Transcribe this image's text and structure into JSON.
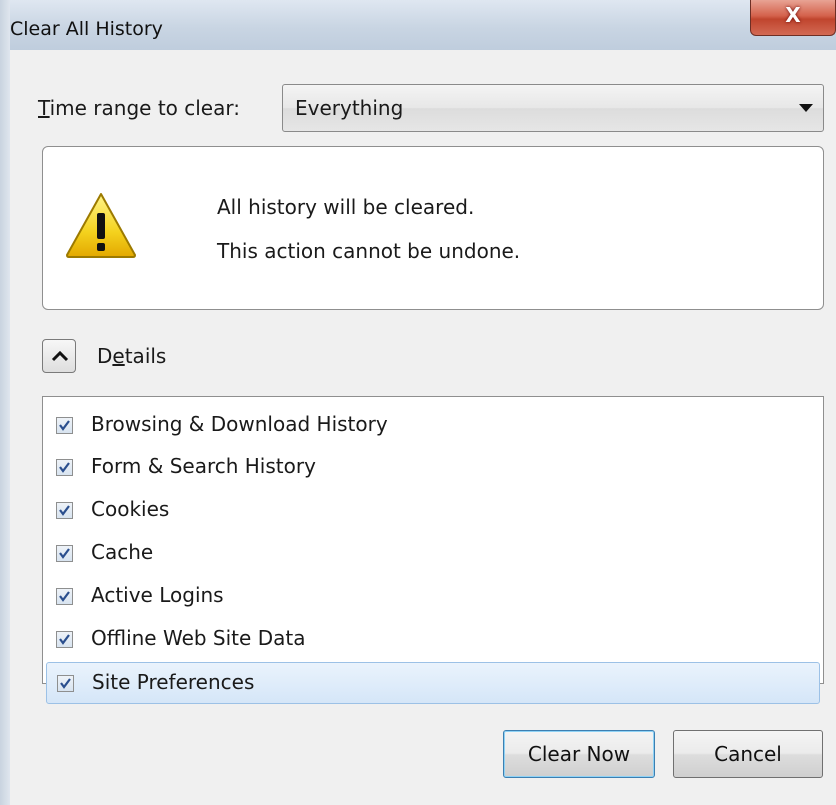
{
  "window": {
    "title": "Clear All History",
    "close_glyph": "X"
  },
  "time_range": {
    "label_first": "T",
    "label_rest": "ime range to clear:",
    "selected": "Everything"
  },
  "warning": {
    "icon": "warning-triangle-icon",
    "line1": "All history will be cleared.",
    "line2": "This action cannot be undone."
  },
  "details": {
    "label_pre": "D",
    "label_ul": "e",
    "label_post": "tails",
    "expanded": true
  },
  "items": [
    {
      "label": "Browsing & Download History",
      "checked": true
    },
    {
      "label": "Form & Search History",
      "checked": true
    },
    {
      "label": "Cookies",
      "checked": true
    },
    {
      "label": "Cache",
      "checked": true
    },
    {
      "label": "Active Logins",
      "checked": true
    },
    {
      "label": "Offline Web Site Data",
      "checked": true
    },
    {
      "label": "Site Preferences",
      "checked": true
    }
  ],
  "buttons": {
    "clear_now": "Clear Now",
    "cancel": "Cancel"
  }
}
